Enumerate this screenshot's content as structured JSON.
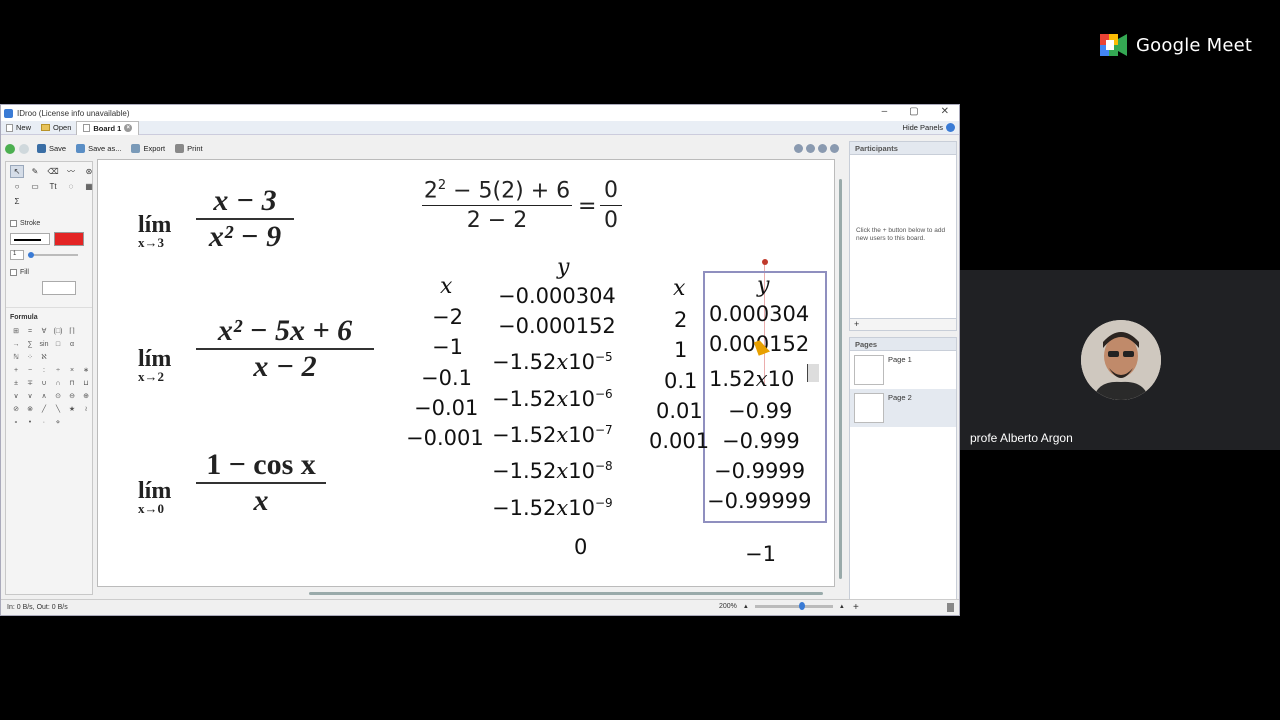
{
  "meet": {
    "logo_text": "Google Meet",
    "participant_name": "profe Alberto Argon"
  },
  "window": {
    "title": "IDroo (License info unavailable)",
    "buttons": [
      "–",
      "▢",
      "✕"
    ]
  },
  "tabs": {
    "new": "New",
    "open": "Open",
    "board": "Board 1",
    "hide_panels": "Hide Panels"
  },
  "toolbar": {
    "save": "Save",
    "save_as": "Save as...",
    "export": "Export",
    "print": "Print"
  },
  "left_panel": {
    "stroke_label": "Stroke",
    "stroke_width": "1",
    "stroke_color": "#e32424",
    "fill_label": "Fill",
    "formula_label": "Formula",
    "tool_row1": [
      "↖",
      "✎",
      "⌫",
      "〰",
      "⊛"
    ],
    "tool_row2": [
      "○",
      "▭",
      "Tt",
      "◌",
      "▦"
    ],
    "tool_row3": [
      "Σ"
    ],
    "formula_symbols": [
      "⊞",
      "=",
      "∀",
      "(□)",
      "⌈⌉",
      "",
      "→",
      "∑",
      "sin",
      "□",
      "α",
      "",
      "ℕ",
      "⁘",
      "ℵ",
      "",
      "",
      "",
      "+",
      "−",
      ":",
      "÷",
      "×",
      "∗",
      "±",
      "∓",
      "∪",
      "∩",
      "⊓",
      "⊔",
      "∨",
      "∨",
      "∧",
      "⊙",
      "⊖",
      "⊕",
      "⊘",
      "⊗",
      "╱",
      "╲",
      "★",
      "≀",
      "∘",
      "•",
      "∙",
      "⋄"
    ]
  },
  "board": {
    "limits": [
      {
        "lim": "lím",
        "sub": "x→3",
        "num": "x − 3",
        "den": "x² − 9"
      },
      {
        "lim": "lím",
        "sub": "x→2",
        "num": "x² − 5x + 6",
        "den": "x − 2"
      },
      {
        "lim": "lím",
        "sub": "x→0",
        "num": "1 − cos x",
        "den": "x"
      }
    ],
    "eval": {
      "num_base": "2",
      "num_exp": "2",
      "num_rest": " − 5(2) + 6",
      "den": "2 − 2",
      "eq": "=",
      "rnum": "0",
      "rden": "0"
    },
    "table1": {
      "x_head": "x",
      "y_head": "y",
      "x": [
        "−2",
        "−1",
        "−0.1",
        "−0.01",
        "−0.001"
      ],
      "y": [
        "−0.000304",
        "−0.000152"
      ],
      "y_sci": [
        {
          "mant": "−1.52",
          "x": "x",
          "base": "10",
          "exp": "−5"
        },
        {
          "mant": "−1.52",
          "x": "x",
          "base": "10",
          "exp": "−6"
        },
        {
          "mant": "−1.52",
          "x": "x",
          "base": "10",
          "exp": "−7"
        },
        {
          "mant": "−1.52",
          "x": "x",
          "base": "10",
          "exp": "−8"
        },
        {
          "mant": "−1.52",
          "x": "x",
          "base": "10",
          "exp": "−9"
        }
      ],
      "result": "0"
    },
    "table2": {
      "x_head": "x",
      "y_head": "y",
      "x": [
        "2",
        "1",
        "0.1",
        "0.01",
        "0.001"
      ],
      "y": [
        "0.000304",
        "0.000152",
        "1.52",
        "−0.99",
        "−0.999",
        "−0.9999",
        "−0.99999"
      ],
      "y_sci_x": "x",
      "y_sci_base": "10",
      "result": "−1"
    }
  },
  "right_panel": {
    "participants_title": "Participants",
    "participants_hint": "Click the + button below to add new users to this board.",
    "add_symbol": "+",
    "pages_title": "Pages",
    "pages": [
      "Page 1",
      "Page 2"
    ]
  },
  "status": {
    "traffic": "In: 0 B/s, Out: 0 B/s",
    "zoom": "200%"
  }
}
